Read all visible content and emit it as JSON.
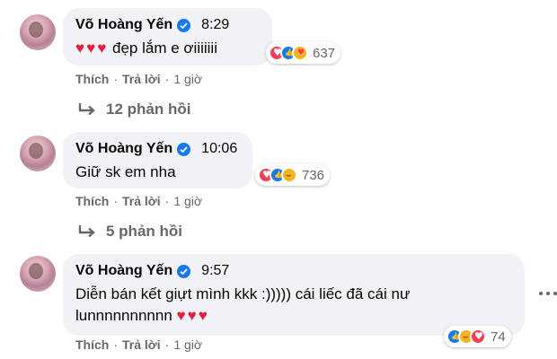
{
  "comments": [
    {
      "author": "Võ Hoàng Yến",
      "time": "8:29",
      "text": "đẹp lắm e ơiiiiiii",
      "hearts": "♥♥♥",
      "reactions": [
        "love",
        "like",
        "care"
      ],
      "reaction_count": "637",
      "actions": {
        "like": "Thích",
        "reply": "Trả lời",
        "ago": "1 giờ"
      },
      "replies": "12 phản hồi"
    },
    {
      "author": "Võ Hoàng Yến",
      "time": "10:06",
      "text": "Giữ sk em nha",
      "reactions": [
        "love",
        "like",
        "haha"
      ],
      "reaction_count": "736",
      "actions": {
        "like": "Thích",
        "reply": "Trả lời",
        "ago": "1 giờ"
      },
      "replies": "5 phản hồi"
    },
    {
      "author": "Võ Hoàng Yến",
      "time": "9:57",
      "text_line1": "Diễn bán kết giựt mình kkk :))))) cái liếc đã cái nư",
      "text_line2": "lunnnnnnnnnn",
      "hearts": "♥♥♥",
      "reactions": [
        "like",
        "haha",
        "love"
      ],
      "reaction_count": "74",
      "actions": {
        "like": "Thích",
        "reply": "Trả lời",
        "ago": "1 giờ"
      }
    }
  ],
  "colors": {
    "bubble": "#f0f2f5",
    "verified": "#1877f2",
    "heart": "#e41e3f",
    "muted": "#65676b"
  }
}
